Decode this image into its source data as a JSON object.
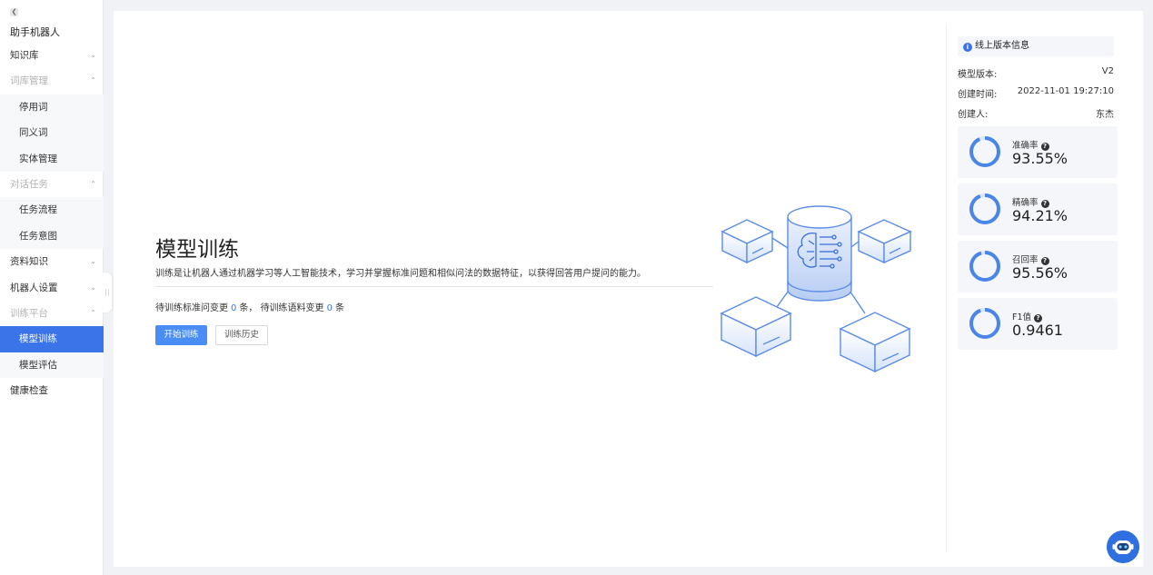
{
  "sidebar": {
    "collapse_icon": "chevron-left-icon",
    "app_title": "助手机器人",
    "items": [
      {
        "label": "知识库",
        "kind": "top",
        "chevron": "⌄"
      },
      {
        "label": "词库管理",
        "kind": "group-muted",
        "chevron": "⌃"
      },
      {
        "label": "停用词",
        "kind": "sub"
      },
      {
        "label": "同义词",
        "kind": "sub"
      },
      {
        "label": "实体管理",
        "kind": "sub"
      },
      {
        "label": "对话任务",
        "kind": "group-muted",
        "chevron": "⌃"
      },
      {
        "label": "任务流程",
        "kind": "sub"
      },
      {
        "label": "任务意图",
        "kind": "sub"
      },
      {
        "label": "资料知识",
        "kind": "top",
        "chevron": "⌄"
      },
      {
        "label": "机器人设置",
        "kind": "top",
        "chevron": "⌄"
      },
      {
        "label": "训练平台",
        "kind": "group-muted",
        "chevron": "⌃"
      },
      {
        "label": "模型训练",
        "kind": "sub-active"
      },
      {
        "label": "模型评估",
        "kind": "sub"
      },
      {
        "label": "健康检查",
        "kind": "top"
      }
    ]
  },
  "main": {
    "title": "模型训练",
    "description": "训练是让机器人通过机器学习等人工智能技术，学习并掌握标准问题和相似问法的数据特征，以获得回答用户提问的能力。",
    "pending": {
      "prefix1": "待训练标准问变更",
      "count1": "0",
      "suffix1": "条，",
      "prefix2": "待训练语料变更",
      "count2": "0",
      "suffix2": "条"
    },
    "start_button": "开始训练",
    "history_button": "训练历史"
  },
  "info": {
    "header": "线上版本信息",
    "header_icon": "info-icon",
    "rows": [
      {
        "label": "模型版本:",
        "value": "V2"
      },
      {
        "label": "创建时间:",
        "value": "2022-11-01 19:27:10"
      },
      {
        "label": "创建人:",
        "value": "东杰"
      }
    ],
    "metrics": [
      {
        "label": "准确率",
        "value": "93.55%",
        "ratio": 0.9355
      },
      {
        "label": "精确率",
        "value": "94.21%",
        "ratio": 0.9421
      },
      {
        "label": "召回率",
        "value": "95.56%",
        "ratio": 0.9556
      },
      {
        "label": "F1值",
        "value": "0.9461",
        "ratio": 0.9461
      }
    ]
  },
  "colors": {
    "accent": "#3b73e8",
    "primary_button": "#4a8ef5",
    "ring": "#4a86e8",
    "ring_track": "#dce6f7"
  },
  "floating": {
    "icon": "robot-assistant-icon"
  }
}
